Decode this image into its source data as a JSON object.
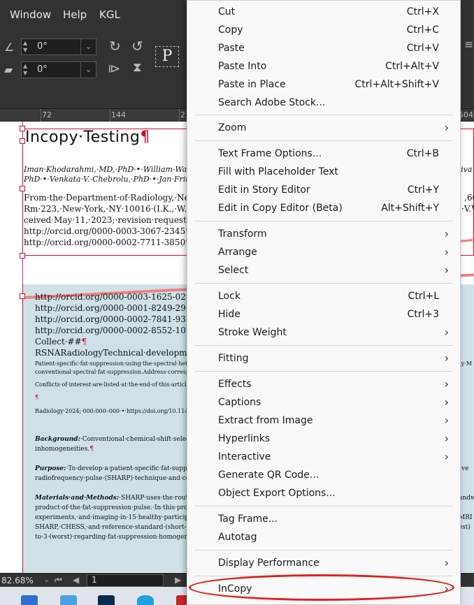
{
  "menubar": {
    "items": [
      "Window",
      "Help",
      "KGL"
    ]
  },
  "controls": {
    "rotate_value": "0°",
    "shear_value": "0°",
    "frame_letter": "P"
  },
  "ruler": {
    "labels": [
      "72",
      "144",
      "2",
      "504"
    ]
  },
  "document": {
    "title": "Incopy·Testing",
    "pilcrow": "¶",
    "authors_line1": "Iman·Khodarahmi,·MD,·PhD·•·William·Wal",
    "authors_line1_right": "hiva",
    "authors_line2": "PhD·•·Venkata·V.·Chebrolu,·PhD·•·Jan·Fritz",
    "affil_lines": [
      "From·the·Department·of·Radiology,·New·Yor",
      "Rm·223,·New·York,·NY·10016·(I.K.,·W.W.,",
      "ceived·May·11,·2023;·revision·requested·June",
      "http://orcid.org/0000-0003-3067-2345",
      "http://orcid.org/0000-0002-7711-3850"
    ],
    "affil_right": [
      ",66",
      "·V.V."
    ],
    "orcid_lines": [
      "http://orcid.org/0000-0003-1625-0293",
      "http://orcid.org/0000-0001-8249-2907",
      "http://orcid.org/0000-0002-7841-9333",
      "http://orcid.org/0000-0002-8552-107X"
    ],
    "collect": "Collect·##",
    "rsna": "RSNARadiologyTechnical·development23",
    "small_lines": [
      "Patient-specific·fat·suppression·using·the·spectral·heteroge",
      "conventional·spectral·fat·suppression.Address·corresponden"
    ],
    "small_right": "ity·M",
    "conflicts": "Conflicts·of·interest·are·listed·at·the·end·of·this·article.",
    "radiology_line": "Radiology·2024;·000:000–000·•·https://doi.org/10.114",
    "background_label": "Background:",
    "background_text": "·Conventional·chemical-shift·selective",
    "background_text2": "inhomogeneities.",
    "purpose_label": "Purpose:",
    "purpose_text": "·To·develop·a·patient-specific·fat-suppres",
    "purpose_right": "ve",
    "purpose_text2": "radiofrequency·pulse·(SHARP)·technique·and·co",
    "methods_label": "Materials·and·Methods:",
    "methods_text": "·SHARP·uses·the·routinely",
    "methods_right": "andw",
    "methods_lines": [
      "product·of·the·fat-suppression·pulse.·In·this·prosp",
      "experiments,·and·imaging·in·15·healthy·participa",
      "SHARP,·CHESS,·and·reference·standard·(short-ta",
      "to·3·(worst)·regarding·fat-suppression·homogenei"
    ],
    "methods_right_lines": [
      "MRI",
      "best)"
    ]
  },
  "statusbar": {
    "zoom": "82.68%",
    "page": "1"
  },
  "menu": {
    "groups": [
      [
        {
          "label": "Cut",
          "shortcut": "Ctrl+X"
        },
        {
          "label": "Copy",
          "shortcut": "Ctrl+C"
        },
        {
          "label": "Paste",
          "shortcut": "Ctrl+V"
        },
        {
          "label": "Paste Into",
          "shortcut": "Ctrl+Alt+V"
        },
        {
          "label": "Paste in Place",
          "shortcut": "Ctrl+Alt+Shift+V"
        },
        {
          "label": "Search Adobe Stock...",
          "shortcut": ""
        }
      ],
      [
        {
          "label": "Zoom",
          "submenu": true
        }
      ],
      [
        {
          "label": "Text Frame Options...",
          "shortcut": "Ctrl+B"
        },
        {
          "label": "Fill with Placeholder Text",
          "shortcut": ""
        },
        {
          "label": "Edit in Story Editor",
          "shortcut": "Ctrl+Y"
        },
        {
          "label": "Edit in Copy Editor (Beta)",
          "shortcut": "Alt+Shift+Y"
        }
      ],
      [
        {
          "label": "Transform",
          "submenu": true
        },
        {
          "label": "Arrange",
          "submenu": true
        },
        {
          "label": "Select",
          "submenu": true
        }
      ],
      [
        {
          "label": "Lock",
          "shortcut": "Ctrl+L"
        },
        {
          "label": "Hide",
          "shortcut": "Ctrl+3"
        },
        {
          "label": "Stroke Weight",
          "submenu": true
        }
      ],
      [
        {
          "label": "Fitting",
          "submenu": true
        }
      ],
      [
        {
          "label": "Effects",
          "submenu": true
        },
        {
          "label": "Captions",
          "submenu": true
        },
        {
          "label": "Extract from Image",
          "submenu": true
        },
        {
          "label": "Hyperlinks",
          "submenu": true
        },
        {
          "label": "Interactive",
          "submenu": true
        },
        {
          "label": "Generate QR Code...",
          "shortcut": ""
        },
        {
          "label": "Object Export Options...",
          "shortcut": ""
        }
      ],
      [
        {
          "label": "Tag Frame...",
          "shortcut": ""
        },
        {
          "label": "Autotag",
          "shortcut": ""
        }
      ],
      [
        {
          "label": "Display Performance",
          "submenu": true
        }
      ],
      [
        {
          "label": "InCopy",
          "submenu": true
        }
      ]
    ]
  },
  "colors": {
    "accent_red": "#e02020",
    "frame_red": "#c8102e",
    "guide_purple": "#a23aa7",
    "frame_fill": "#cfe1e6"
  }
}
